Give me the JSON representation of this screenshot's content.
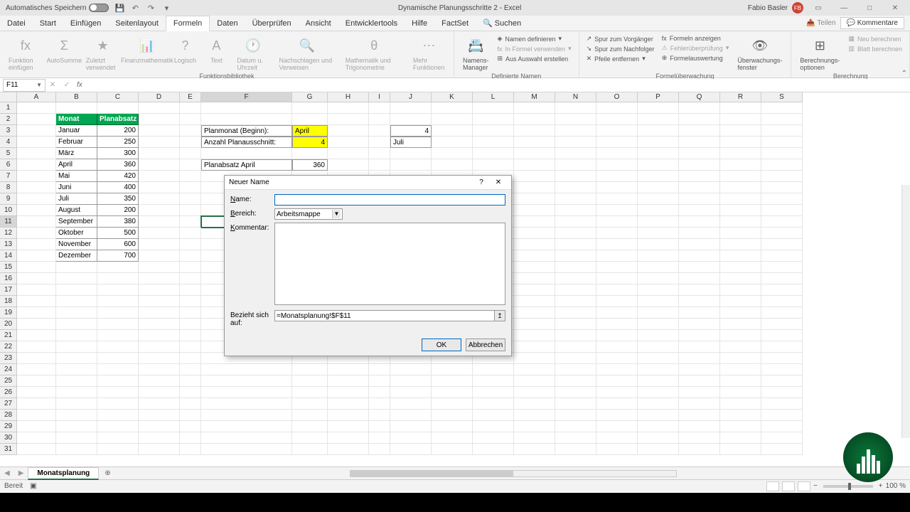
{
  "titlebar": {
    "autosave": "Automatisches Speichern",
    "doc_title": "Dynamische Planungsschritte 2 - Excel",
    "user_name": "Fabio Basler",
    "user_initials": "FB"
  },
  "menubar": {
    "items": [
      "Datei",
      "Start",
      "Einfügen",
      "Seitenlayout",
      "Formeln",
      "Daten",
      "Überprüfen",
      "Ansicht",
      "Entwicklertools",
      "Hilfe",
      "FactSet",
      "Suchen"
    ],
    "active_index": 4,
    "share": "Teilen",
    "comments": "Kommentare"
  },
  "ribbon": {
    "g1": {
      "fn_insert": "Funktion einfügen",
      "autosum": "AutoSumme",
      "recent": "Zuletzt verwendet",
      "finance": "Finanzmathematik",
      "logic": "Logisch",
      "text": "Text",
      "datetime": "Datum u. Uhrzeit",
      "lookup": "Nachschlagen und Verweisen",
      "math": "Mathematik und Trigonometrie",
      "more": "Mehr Funktionen",
      "label": "Funktionsbibliothek"
    },
    "g2": {
      "name_mgr": "Namens-Manager",
      "define": "Namen definieren",
      "use": "In Formel verwenden",
      "create": "Aus Auswahl erstellen",
      "label": "Definierte Namen"
    },
    "g3": {
      "trace_prec": "Spur zum Vorgänger",
      "trace_dep": "Spur zum Nachfolger",
      "remove": "Pfeile entfernen",
      "show_formulas": "Formeln anzeigen",
      "error_check": "Fehlerüberprüfung",
      "eval": "Formelauswertung",
      "watch": "Überwachungs-fenster",
      "label": "Formelüberwachung"
    },
    "g4": {
      "calc_opts": "Berechnungs-optionen",
      "calc_now": "Neu berechnen",
      "calc_sheet": "Blatt berechnen",
      "label": "Berechnung"
    }
  },
  "namebox": "F11",
  "columns": [
    "A",
    "B",
    "C",
    "D",
    "E",
    "F",
    "G",
    "H",
    "I",
    "J",
    "K",
    "L",
    "M",
    "N",
    "O",
    "P",
    "Q",
    "R",
    "S"
  ],
  "table": {
    "header": {
      "monat": "Monat",
      "planabsatz": "Planabsatz"
    },
    "rows": [
      {
        "m": "Januar",
        "v": "200"
      },
      {
        "m": "Februar",
        "v": "250"
      },
      {
        "m": "März",
        "v": "300"
      },
      {
        "m": "April",
        "v": "360"
      },
      {
        "m": "Mai",
        "v": "420"
      },
      {
        "m": "Juni",
        "v": "400"
      },
      {
        "m": "Juli",
        "v": "350"
      },
      {
        "m": "August",
        "v": "200"
      },
      {
        "m": "September",
        "v": "380"
      },
      {
        "m": "Oktober",
        "v": "500"
      },
      {
        "m": "November",
        "v": "600"
      },
      {
        "m": "Dezember",
        "v": "700"
      }
    ]
  },
  "inputs": {
    "planmonat_label": "Planmonat (Beginn):",
    "planmonat_value": "April",
    "anzahl_label": "Anzahl Planausschnitt:",
    "anzahl_value": "4",
    "calc1": "4",
    "calc2": "Juli",
    "planabsatz_label": "Planabsatz April",
    "planabsatz_value": "360"
  },
  "dialog": {
    "title": "Neuer Name",
    "name_label": "Name:",
    "name_value": "",
    "scope_label": "Bereich:",
    "scope_value": "Arbeitsmappe",
    "comment_label": "Kommentar:",
    "refers_label": "Bezieht sich auf:",
    "refers_value": "=Monatsplanung!$F$11",
    "ok": "OK",
    "cancel": "Abbrechen"
  },
  "sheet_tab": "Monatsplanung",
  "status": {
    "ready": "Bereit",
    "zoom": "100 %"
  }
}
